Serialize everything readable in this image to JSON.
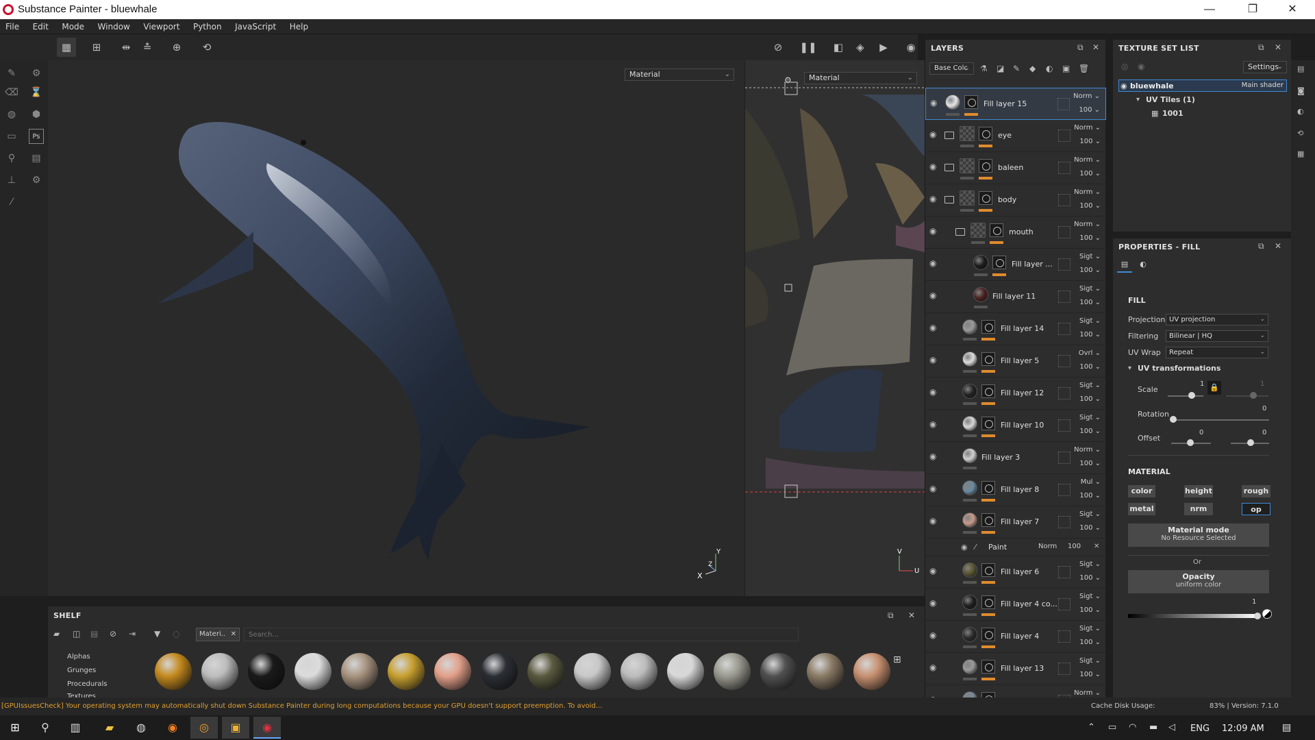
{
  "window": {
    "title": "Substance Painter - bluewhale",
    "minimize": "—",
    "restore": "❐",
    "close": "✕"
  },
  "menu": [
    "File",
    "Edit",
    "Mode",
    "Window",
    "Viewport",
    "Python",
    "JavaScript",
    "Help"
  ],
  "viewport": {
    "material_dropdown_3d": "Material",
    "material_dropdown_2d": "Material",
    "axis_3d_x": "X",
    "axis_3d_y": "Y",
    "axis_3d_z": "Z",
    "axis_2d_v": "V",
    "axis_2d_u": "U"
  },
  "layers_panel": {
    "title": "LAYERS",
    "channel_select": "Base Colc",
    "layers": [
      {
        "name": "Fill layer 15",
        "blend": "Norm",
        "opacity": "100",
        "selected": true,
        "thumb": "#e6e6e6",
        "folder": false,
        "indent": 0
      },
      {
        "name": "eye",
        "blend": "Norm",
        "opacity": "100",
        "selected": false,
        "thumb": "#555555",
        "folder": true,
        "indent": 0
      },
      {
        "name": "baleen",
        "blend": "Norm",
        "opacity": "100",
        "selected": false,
        "thumb": "#555555",
        "folder": true,
        "indent": 0
      },
      {
        "name": "body",
        "blend": "Norm",
        "opacity": "100",
        "selected": false,
        "thumb": "#555555",
        "folder": true,
        "indent": 0
      },
      {
        "name": "mouth",
        "blend": "Norm",
        "opacity": "100",
        "selected": false,
        "thumb": "#555555",
        "folder": true,
        "indent": 1
      },
      {
        "name": "Fill layer ...",
        "blend": "Sigt",
        "opacity": "100",
        "selected": false,
        "thumb": "#1b1b1b",
        "folder": false,
        "indent": 2
      },
      {
        "name": "Fill layer 11",
        "blend": "Sigt",
        "opacity": "100",
        "selected": false,
        "thumb": "#4a2020",
        "folder": false,
        "indent": 2,
        "nomask": true
      },
      {
        "name": "Fill layer 14",
        "blend": "Sigt",
        "opacity": "100",
        "selected": false,
        "thumb": "#9a9a9a",
        "folder": false,
        "indent": 1
      },
      {
        "name": "Fill layer 5",
        "blend": "Ovrl",
        "opacity": "100",
        "selected": false,
        "thumb": "#dcdcdc",
        "folder": false,
        "indent": 1
      },
      {
        "name": "Fill layer 12",
        "blend": "Sigt",
        "opacity": "100",
        "selected": false,
        "thumb": "#222222",
        "folder": false,
        "indent": 1
      },
      {
        "name": "Fill layer 10",
        "blend": "Sigt",
        "opacity": "100",
        "selected": false,
        "thumb": "#d8d8d8",
        "folder": false,
        "indent": 1
      },
      {
        "name": "Fill layer 3",
        "blend": "Norm",
        "opacity": "100",
        "selected": false,
        "thumb": "#d0d0d0",
        "folder": false,
        "indent": 1,
        "nomask": true
      },
      {
        "name": "Fill layer 8",
        "blend": "Mul",
        "opacity": "100",
        "selected": false,
        "thumb": "#6b8aa0",
        "folder": false,
        "indent": 1
      },
      {
        "name": "Fill layer 7",
        "blend": "Sigt",
        "opacity": "100",
        "selected": false,
        "thumb": "#c79a8a",
        "folder": false,
        "indent": 1
      }
    ],
    "paint_row": {
      "name": "Paint",
      "blend": "Norm",
      "opacity": "100"
    },
    "layers_after": [
      {
        "name": "Fill layer 6",
        "blend": "Sigt",
        "opacity": "100",
        "thumb": "#5a5530"
      },
      {
        "name": "Fill layer 4 co...",
        "blend": "Sigt",
        "opacity": "100",
        "thumb": "#1e1e1e"
      },
      {
        "name": "Fill layer 4",
        "blend": "Sigt",
        "opacity": "100",
        "thumb": "#2a2a2a"
      },
      {
        "name": "Fill layer 13",
        "blend": "Sigt",
        "opacity": "100",
        "thumb": "#9a9a9a"
      },
      {
        "name": "",
        "blend": "Norm",
        "opacity": "",
        "thumb": "#7a8a9a"
      }
    ]
  },
  "texture_set_list": {
    "title": "TEXTURE SET LIST",
    "settings": "Settings",
    "set_name": "bluewhale",
    "shader": "Main shader",
    "uv_tiles": "UV Tiles (1)",
    "tile": "1001"
  },
  "properties": {
    "title": "PROPERTIES - FILL",
    "section_fill": "FILL",
    "projection_label": "Projection",
    "projection_value": "UV projection",
    "filtering_label": "Filtering",
    "filtering_value": "Bilinear | HQ",
    "uvwrap_label": "UV Wrap",
    "uvwrap_value": "Repeat",
    "uv_transforms": "UV transformations",
    "scale_label": "Scale",
    "scale_value": "1",
    "scale_value_locked": "1",
    "rotation_label": "Rotation",
    "rotation_value": "0",
    "offset_label": "Offset",
    "offset_u": "0",
    "offset_v": "0",
    "section_material": "MATERIAL",
    "channels": [
      "color",
      "height",
      "rough",
      "metal",
      "nrm",
      "op"
    ],
    "material_mode": "Material mode",
    "no_resource": "No Resource Selected",
    "or": "Or",
    "opacity_title": "Opacity",
    "opacity_sub": "uniform color",
    "opacity_value": "1"
  },
  "shelf": {
    "title": "SHELF",
    "filter_tag": "Materi..",
    "search_placeholder": "Search...",
    "categories": [
      "Alphas",
      "Grunges",
      "Procedurals",
      "Textures"
    ],
    "materials": [
      {
        "color": "#c58a1e"
      },
      {
        "color": "#bdbdbd"
      },
      {
        "color": "#1a1a1a"
      },
      {
        "color": "#dcdcdc"
      },
      {
        "color": "#a89480"
      },
      {
        "color": "#c8a030"
      },
      {
        "color": "#e3a08a"
      },
      {
        "color": "#2b2f35"
      },
      {
        "color": "#5a5a40"
      },
      {
        "color": "#c8c8c8"
      },
      {
        "color": "#bcbcbc"
      },
      {
        "color": "#d8d8d8"
      },
      {
        "color": "#9a9a90"
      },
      {
        "color": "#505050"
      },
      {
        "color": "#8a7a65"
      },
      {
        "color": "#c89070"
      }
    ]
  },
  "status": {
    "message": "[GPUIssuesCheck] Your operating system may automatically shut down Substance Painter during long computations because your GPU doesn't support preemption. To avoid...",
    "cache": "Cache Disk Usage:",
    "version": "83% | Version: 7.1.0"
  },
  "taskbar": {
    "lang": "ENG",
    "time": "12:09 AM"
  },
  "colors": {
    "accent": "#3f8bd6",
    "mask_orange": "#e08b2d",
    "status_warning": "#e0a030"
  }
}
